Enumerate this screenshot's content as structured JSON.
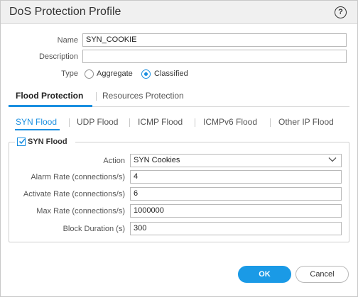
{
  "dialog": {
    "title": "DoS Protection Profile",
    "help_icon": "?"
  },
  "form": {
    "name_label": "Name",
    "name_value": "SYN_COOKIE",
    "description_label": "Description",
    "description_value": "",
    "type_label": "Type",
    "type_options": [
      {
        "label": "Aggregate",
        "selected": false
      },
      {
        "label": "Classified",
        "selected": true
      }
    ]
  },
  "tabs": [
    {
      "label": "Flood Protection",
      "active": true
    },
    {
      "label": "Resources Protection",
      "active": false
    }
  ],
  "subtabs": [
    {
      "label": "SYN Flood",
      "active": true
    },
    {
      "label": "UDP Flood",
      "active": false
    },
    {
      "label": "ICMP Flood",
      "active": false
    },
    {
      "label": "ICMPv6 Flood",
      "active": false
    },
    {
      "label": "Other IP Flood",
      "active": false
    }
  ],
  "syn_flood": {
    "enabled_label": "SYN Flood",
    "enabled": true,
    "action_label": "Action",
    "action_value": "SYN Cookies",
    "alarm_rate_label": "Alarm Rate (connections/s)",
    "alarm_rate_value": "4",
    "activate_rate_label": "Activate Rate (connections/s)",
    "activate_rate_value": "6",
    "max_rate_label": "Max Rate (connections/s)",
    "max_rate_value": "1000000",
    "block_duration_label": "Block Duration (s)",
    "block_duration_value": "300"
  },
  "buttons": {
    "ok": "OK",
    "cancel": "Cancel"
  },
  "colors": {
    "accent": "#1a8fe0",
    "ok_button": "#1a9ae6"
  }
}
